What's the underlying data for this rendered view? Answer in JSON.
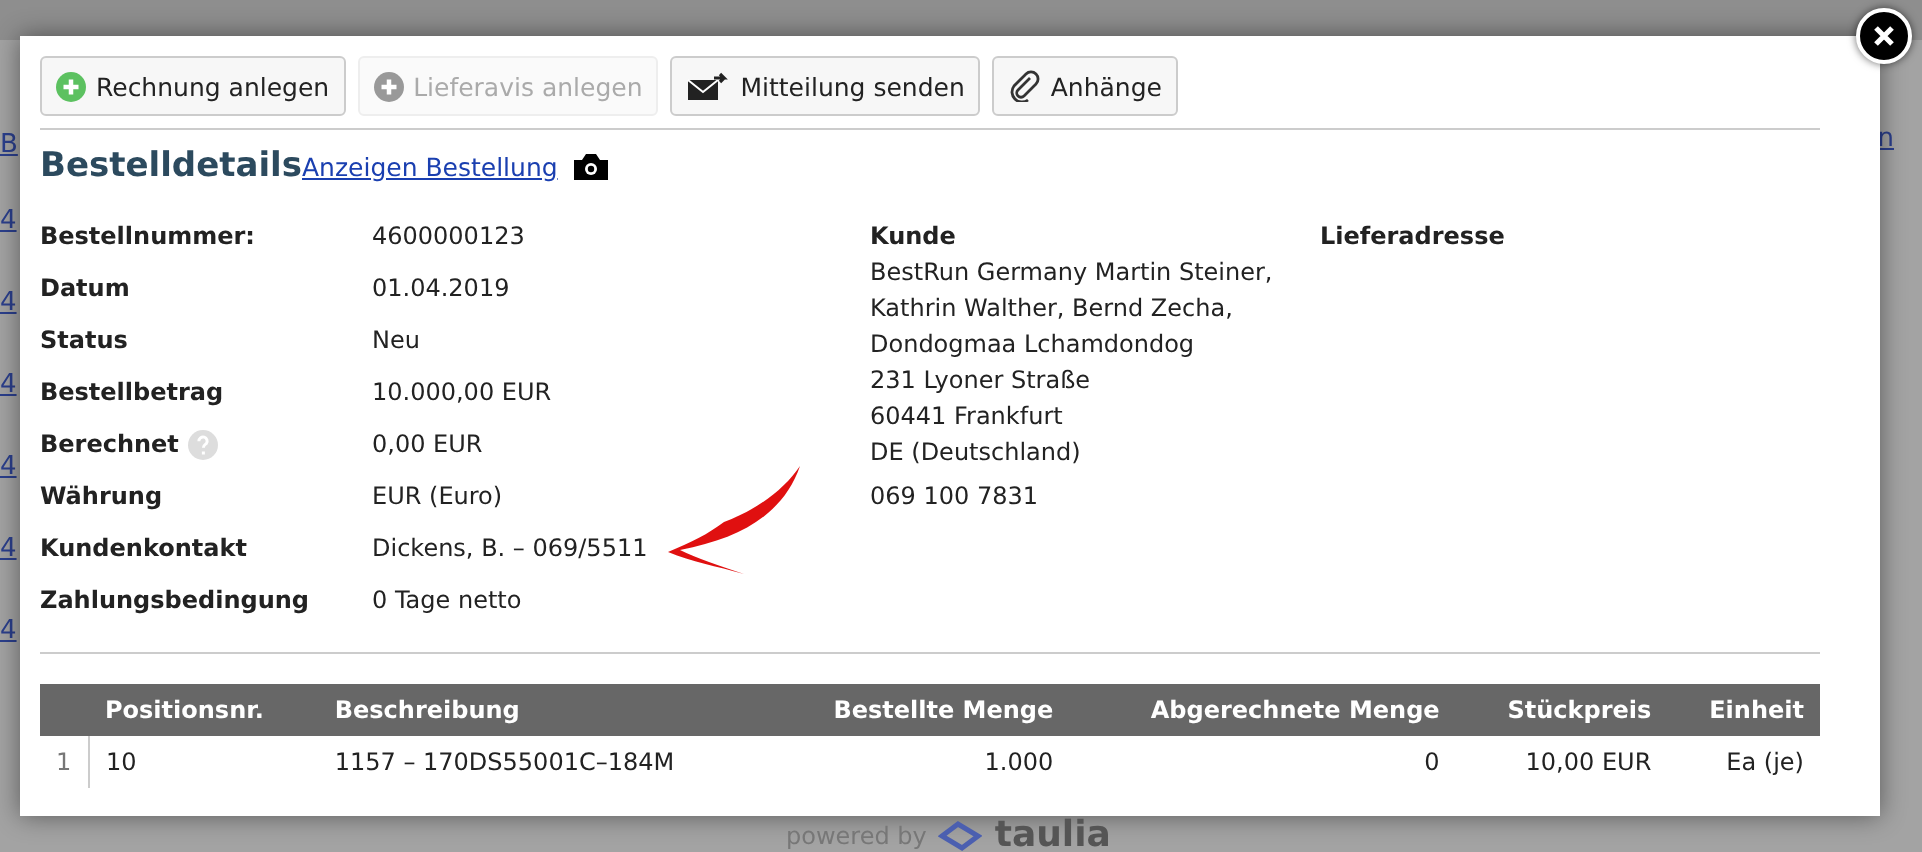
{
  "background_page": {
    "header_link": "B",
    "right_link": "n",
    "row_links": [
      "4",
      "4",
      "4",
      "4",
      "4",
      "4"
    ]
  },
  "toolbar": [
    {
      "label": "Rechnung anlegen",
      "kind": "add",
      "disabled": false
    },
    {
      "label": "Lieferavis anlegen",
      "kind": "add",
      "disabled": true
    },
    {
      "label": "Mitteilung senden",
      "kind": "mail",
      "disabled": false
    },
    {
      "label": "Anhänge",
      "kind": "attach",
      "disabled": false
    }
  ],
  "title": "Bestelldetails",
  "title_link": "Anzeigen Bestellung",
  "details": [
    {
      "label": "Bestellnummer:",
      "value": "4600000123",
      "help": false
    },
    {
      "label": "Datum",
      "value": "01.04.2019",
      "help": false
    },
    {
      "label": "Status",
      "value": "Neu",
      "help": false
    },
    {
      "label": "Bestellbetrag",
      "value": "10.000,00 EUR",
      "help": false
    },
    {
      "label": "Berechnet",
      "value": "0,00 EUR",
      "help": true
    },
    {
      "label": "Währung",
      "value": "EUR (Euro)",
      "help": false
    },
    {
      "label": "Kundenkontakt",
      "value": "Dickens, B. – 069/5511",
      "help": false
    },
    {
      "label": "Zahlungsbedingung",
      "value": "0 Tage netto",
      "help": false
    }
  ],
  "customer": {
    "heading": "Kunde",
    "address_lines": [
      "BestRun Germany Martin Steiner,",
      "Kathrin Walther, Bernd Zecha,",
      "Dondogmaa Lchamdondog",
      "231 Lyoner Straße",
      "60441 Frankfurt",
      "DE (Deutschland)"
    ],
    "phone": "069 100 7831"
  },
  "delivery": {
    "heading": "Lieferadresse"
  },
  "table": {
    "columns": [
      "Positionsnr.",
      "Beschreibung",
      "Bestellte Menge",
      "Abgerechnete Menge",
      "Stückpreis",
      "Einheit"
    ],
    "rows": [
      {
        "index": "1",
        "cells": [
          "10",
          "1157 – 170DS55001C–184M",
          "1.000",
          "0",
          "10,00 EUR",
          "Ea (je)"
        ]
      }
    ]
  },
  "footer": {
    "prefix": "powered by",
    "brand": "taulia"
  }
}
